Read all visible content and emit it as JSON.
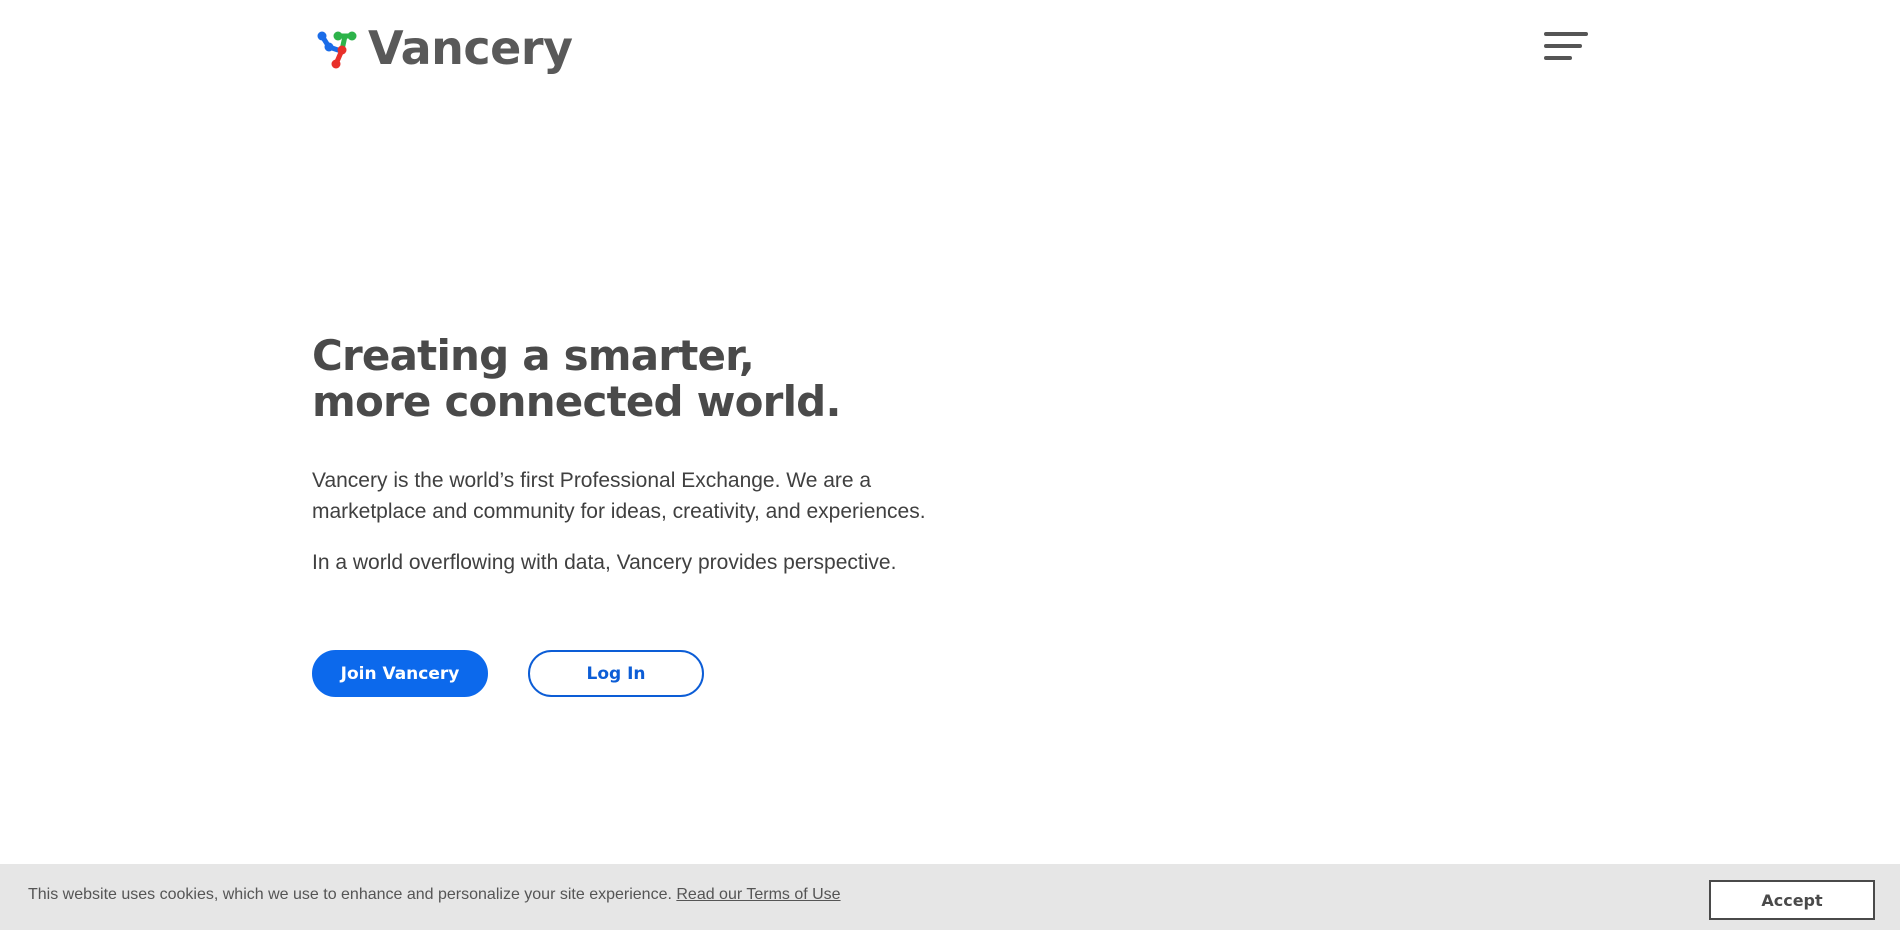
{
  "header": {
    "logo_text": "Vancery",
    "menu_icon": "hamburger-menu-icon"
  },
  "hero": {
    "title_line1": "Creating a smarter,",
    "title_line2": "more connected world.",
    "paragraph1": "Vancery is the world’s first Professional Exchange. We are a marketplace and community for ideas, creativity, and experiences.",
    "paragraph2": "In a world overflowing with data, Vancery provides perspective.",
    "join_label": "Join Vancery",
    "login_label": "Log In"
  },
  "cookie": {
    "message": "This website uses cookies, which we use to enhance and personalize your site experience. ",
    "link_label": "Read our Terms of Use",
    "accept_label": "Accept"
  },
  "colors": {
    "primary": "#0c69ec",
    "text": "#4a4a4a",
    "cookie_bg": "#e6e6e6",
    "logo_blue": "#1a6ce8",
    "logo_green": "#2db34a",
    "logo_red": "#e8302a"
  }
}
